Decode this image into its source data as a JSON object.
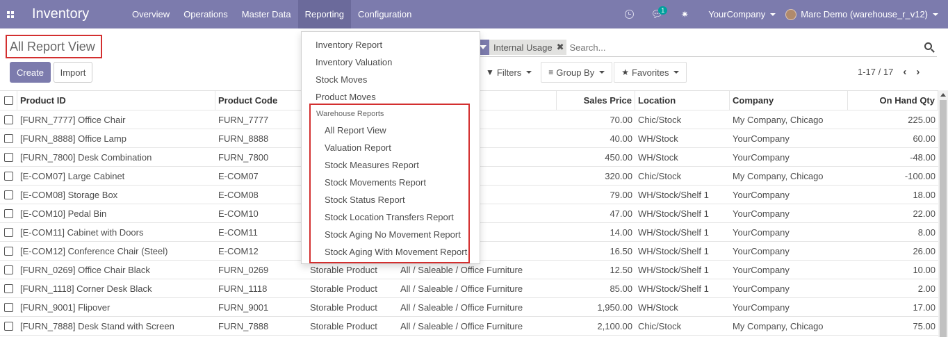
{
  "navbar": {
    "app_title": "Inventory",
    "menu": [
      "Overview",
      "Operations",
      "Master Data",
      "Reporting",
      "Configuration"
    ],
    "chat_badge": "1",
    "company": "YourCompany",
    "user": "Marc Demo (warehouse_r_v12)",
    "color": "#7c7bad"
  },
  "control": {
    "breadcrumb": "All Report View",
    "create_label": "Create",
    "import_label": "Import",
    "facet_label": "Internal Usage",
    "search_placeholder": "Search...",
    "filters_label": "Filters",
    "groupby_label": "Group By",
    "favorites_label": "Favorites",
    "pager": "1-17 / 17"
  },
  "reporting_menu": {
    "items": [
      "Inventory Report",
      "Inventory Valuation",
      "Stock Moves",
      "Product Moves"
    ],
    "section_header": "Warehouse Reports",
    "sub_items": [
      "All Report View",
      "Valuation Report",
      "Stock Measures Report",
      "Stock Movements Report",
      "Stock Status Report",
      "Stock Location Transfers Report",
      "Stock Aging No Movement Report",
      "Stock Aging With Movement Report"
    ]
  },
  "table": {
    "headers": {
      "pid": "Product ID",
      "pcode": "Product Code",
      "price": "Sales Price",
      "location": "Location",
      "company": "Company",
      "qty": "On Hand Qty"
    },
    "rows": [
      {
        "pid": "[FURN_7777] Office Chair",
        "pcode": "FURN_7777",
        "type": "",
        "cat": "e Furniture",
        "price": "70.00",
        "loc": "Chic/Stock",
        "comp": "My Company, Chicago",
        "qty": "225.00"
      },
      {
        "pid": "[FURN_8888] Office Lamp",
        "pcode": "FURN_8888",
        "type": "",
        "cat": "e Furniture",
        "price": "40.00",
        "loc": "WH/Stock",
        "comp": "YourCompany",
        "qty": "60.00"
      },
      {
        "pid": "[FURN_7800] Desk Combination",
        "pcode": "FURN_7800",
        "type": "",
        "cat": "e Furniture",
        "price": "450.00",
        "loc": "WH/Stock",
        "comp": "YourCompany",
        "qty": "-48.00"
      },
      {
        "pid": "[E-COM07] Large Cabinet",
        "pcode": "E-COM07",
        "type": "",
        "cat": "e Furniture",
        "price": "320.00",
        "loc": "Chic/Stock",
        "comp": "My Company, Chicago",
        "qty": "-100.00"
      },
      {
        "pid": "[E-COM08] Storage Box",
        "pcode": "E-COM08",
        "type": "",
        "cat": "e Furniture",
        "price": "79.00",
        "loc": "WH/Stock/Shelf 1",
        "comp": "YourCompany",
        "qty": "18.00"
      },
      {
        "pid": "[E-COM10] Pedal Bin",
        "pcode": "E-COM10",
        "type": "",
        "cat": "e Furniture",
        "price": "47.00",
        "loc": "WH/Stock/Shelf 1",
        "comp": "YourCompany",
        "qty": "22.00"
      },
      {
        "pid": "[E-COM11] Cabinet with Doors",
        "pcode": "E-COM11",
        "type": "",
        "cat": "e Furniture",
        "price": "14.00",
        "loc": "WH/Stock/Shelf 1",
        "comp": "YourCompany",
        "qty": "8.00"
      },
      {
        "pid": "[E-COM12] Conference Chair (Steel)",
        "pcode": "E-COM12",
        "type": "",
        "cat": "e Furniture",
        "price": "16.50",
        "loc": "WH/Stock/Shelf 1",
        "comp": "YourCompany",
        "qty": "26.00"
      },
      {
        "pid": "[FURN_0269] Office Chair Black",
        "pcode": "FURN_0269",
        "type": "Storable Product",
        "cat": "All / Saleable / Office Furniture",
        "price": "12.50",
        "loc": "WH/Stock/Shelf 1",
        "comp": "YourCompany",
        "qty": "10.00"
      },
      {
        "pid": "[FURN_1118] Corner Desk Black",
        "pcode": "FURN_1118",
        "type": "Storable Product",
        "cat": "All / Saleable / Office Furniture",
        "price": "85.00",
        "loc": "WH/Stock/Shelf 1",
        "comp": "YourCompany",
        "qty": "2.00"
      },
      {
        "pid": "[FURN_9001] Flipover",
        "pcode": "FURN_9001",
        "type": "Storable Product",
        "cat": "All / Saleable / Office Furniture",
        "price": "1,950.00",
        "loc": "WH/Stock",
        "comp": "YourCompany",
        "qty": "17.00"
      },
      {
        "pid": "[FURN_7888] Desk Stand with Screen",
        "pcode": "FURN_7888",
        "type": "Storable Product",
        "cat": "All / Saleable / Office Furniture",
        "price": "2,100.00",
        "loc": "Chic/Stock",
        "comp": "My Company, Chicago",
        "qty": "75.00"
      }
    ]
  }
}
